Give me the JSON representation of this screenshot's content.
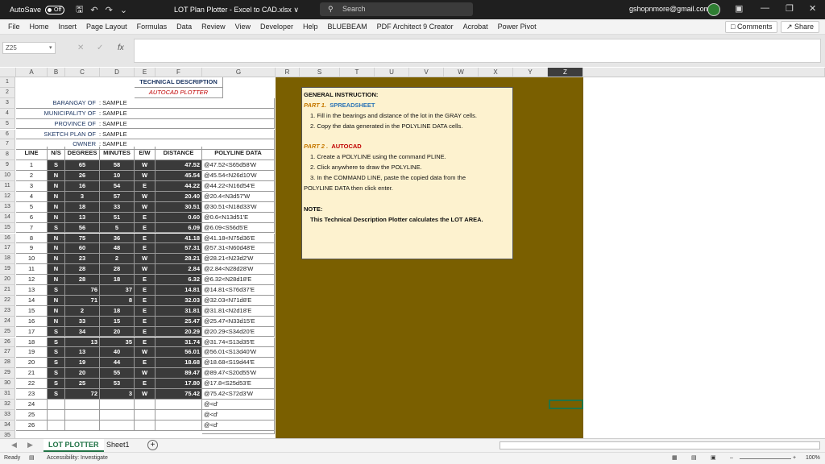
{
  "titlebar": {
    "autosave": "AutoSave",
    "toggle": "Off",
    "title": "LOT Plan Plotter - Excel to CAD.xlsx ∨",
    "search": "Search",
    "account": "gshopnmore@gmail.com"
  },
  "menu": [
    "File",
    "Home",
    "Insert",
    "Page Layout",
    "Formulas",
    "Data",
    "Review",
    "View",
    "Developer",
    "Help",
    "BLUEBEAM",
    "PDF Architect 9 Creator",
    "Acrobat",
    "Power Pivot"
  ],
  "buttons": {
    "comments": "Comments",
    "share": "Share"
  },
  "namebox": "Z25",
  "fx": "fx",
  "columns": [
    "A",
    "B",
    "C",
    "D",
    "E",
    "F",
    "G",
    "R",
    "S",
    "T",
    "U",
    "V",
    "W",
    "X",
    "Y",
    "Z"
  ],
  "header": {
    "title": "TECHNICAL DESCRIPTION",
    "subtitle": "AUTOCAD PLOTTER",
    "fields": [
      {
        "label": "BARANGAY OF",
        "value": ": SAMPLE"
      },
      {
        "label": "MUNICIPALITY OF",
        "value": ": SAMPLE"
      },
      {
        "label": "PROVINCE OF",
        "value": ": SAMPLE"
      },
      {
        "label": "SKETCH PLAN  OF",
        "value": ": SAMPLE"
      },
      {
        "label": "OWNER",
        "value": ": SAMPLE"
      }
    ]
  },
  "table_headers": [
    "LINE",
    "N/S",
    "DEGREES",
    "MINUTES",
    "E/W",
    "DISTANCE",
    "POLYLINE DATA"
  ],
  "rows": [
    [
      "1",
      "S",
      "65",
      "58",
      "W",
      "47.52",
      "@47.52<S65d58'W"
    ],
    [
      "2",
      "N",
      "26",
      "10",
      "W",
      "45.54",
      "@45.54<N26d10'W"
    ],
    [
      "3",
      "N",
      "16",
      "54",
      "E",
      "44.22",
      "@44.22<N16d54'E"
    ],
    [
      "4",
      "N",
      "3",
      "57",
      "W",
      "20.40",
      "@20.4<N3d57'W"
    ],
    [
      "5",
      "N",
      "18",
      "33",
      "W",
      "30.51",
      "@30.51<N18d33'W"
    ],
    [
      "6",
      "N",
      "13",
      "51",
      "E",
      "0.60",
      "@0.6<N13d51'E"
    ],
    [
      "7",
      "S",
      "56",
      "5",
      "E",
      "6.09",
      "@6.09<S56d5'E"
    ],
    [
      "8",
      "N",
      "75",
      "36",
      "E",
      "41.18",
      "@41.18<N75d36'E"
    ],
    [
      "9",
      "N",
      "60",
      "48",
      "E",
      "57.31",
      "@57.31<N60d48'E"
    ],
    [
      "10",
      "N",
      "23",
      "2",
      "W",
      "28.21",
      "@28.21<N23d2'W"
    ],
    [
      "11",
      "N",
      "28",
      "28",
      "W",
      "2.84",
      "@2.84<N28d28'W"
    ],
    [
      "12",
      "N",
      "28",
      "18",
      "E",
      "6.32",
      "@6.32<N28d18'E"
    ],
    [
      "13",
      "S",
      "76",
      "37",
      "E",
      "14.81",
      "@14.81<S76d37'E"
    ],
    [
      "14",
      "N",
      "71",
      "8",
      "E",
      "32.03",
      "@32.03<N71d8'E"
    ],
    [
      "15",
      "N",
      "2",
      "18",
      "E",
      "31.81",
      "@31.81<N2d18'E"
    ],
    [
      "16",
      "N",
      "33",
      "15",
      "E",
      "25.47",
      "@25.47<N33d15'E"
    ],
    [
      "17",
      "S",
      "34",
      "20",
      "E",
      "20.29",
      "@20.29<S34d20'E"
    ],
    [
      "18",
      "S",
      "13",
      "35",
      "E",
      "31.74",
      "@31.74<S13d35'E"
    ],
    [
      "19",
      "S",
      "13",
      "40",
      "W",
      "56.01",
      "@56.01<S13d40'W"
    ],
    [
      "20",
      "S",
      "19",
      "44",
      "E",
      "18.68",
      "@18.68<S19d44'E"
    ],
    [
      "21",
      "S",
      "20",
      "55",
      "W",
      "89.47",
      "@89.47<S20d55'W"
    ],
    [
      "22",
      "S",
      "25",
      "53",
      "E",
      "17.80",
      "@17.8<S25d53'E"
    ],
    [
      "23",
      "S",
      "72",
      "3",
      "W",
      "75.42",
      "@75.42<S72d3'W"
    ],
    [
      "24",
      "",
      "",
      "",
      "",
      "",
      "@<d'"
    ],
    [
      "25",
      "",
      "",
      "",
      "",
      "",
      "@<d'"
    ],
    [
      "26",
      "",
      "",
      "",
      "",
      "",
      "@<d'"
    ]
  ],
  "instructions": {
    "title": "GENERAL INSTRUCTION:",
    "part1_label": "PART 1.",
    "part1_name": "SPREADSHEET",
    "part1_steps": [
      "1. Fill in the bearings and distance of the lot in the GRAY cells.",
      "2. Copy the data generated in the POLYLINE DATA cells."
    ],
    "part2_label": "PART 2 .",
    "part2_name": "AUTOCAD",
    "part2_steps": [
      "1. Create a POLYLINE using the command PLINE.",
      "2. Click anywhere to draw the POLYLINE.",
      "3. In the COMMAND LINE, paste the copied data from the",
      "POLYLINE DATA then click enter."
    ],
    "note_title": "NOTE:",
    "note_text": "This Technical Description Plotter calculates the LOT AREA."
  },
  "tabs": [
    "LOT PLOTTER",
    "Sheet1"
  ],
  "status": {
    "ready": "Ready",
    "accessibility": "Accessibility: Investigate",
    "zoom": "100%"
  },
  "colors": {
    "olive": "#7a5f00",
    "dark_cell": "#3a3a3a",
    "note_bg": "#fdf2cf",
    "excel_green": "#217346"
  }
}
